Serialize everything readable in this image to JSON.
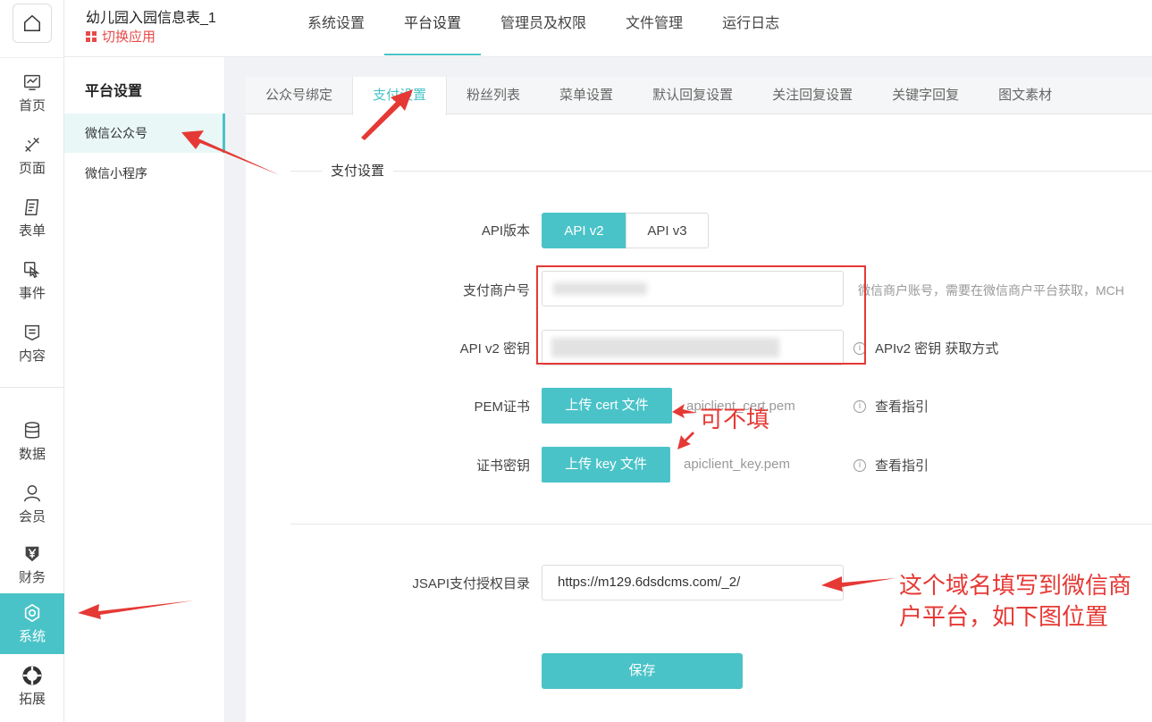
{
  "header": {
    "app_title": "幼儿园入园信息表_1",
    "switch_app": "切换应用",
    "nav": [
      "系统设置",
      "平台设置",
      "管理员及权限",
      "文件管理",
      "运行日志"
    ],
    "active_nav": "平台设置"
  },
  "rail": {
    "items": [
      {
        "label": "首页",
        "icon": "dashboard-icon"
      },
      {
        "label": "页面",
        "icon": "design-icon"
      },
      {
        "label": "表单",
        "icon": "form-icon"
      },
      {
        "label": "事件",
        "icon": "touch-icon"
      },
      {
        "label": "内容",
        "icon": "content-icon"
      },
      {
        "label": "数据",
        "icon": "database-icon"
      },
      {
        "label": "会员",
        "icon": "user-icon"
      },
      {
        "label": "财务",
        "icon": "yen-icon"
      },
      {
        "label": "系统",
        "icon": "settings-icon"
      },
      {
        "label": "拓展",
        "icon": "extension-icon"
      }
    ],
    "active": "系统"
  },
  "subnav": {
    "title": "平台设置",
    "items": [
      "微信公众号",
      "微信小程序"
    ],
    "active": "微信公众号"
  },
  "tabs": {
    "items": [
      "公众号绑定",
      "支付设置",
      "粉丝列表",
      "菜单设置",
      "默认回复设置",
      "关注回复设置",
      "关键字回复",
      "图文素材"
    ],
    "active": "支付设置"
  },
  "form": {
    "section_title": "支付设置",
    "api_version_label": "API版本",
    "api_options": [
      "API v2",
      "API v3"
    ],
    "api_selected": "API v2",
    "merchant_label": "支付商户号",
    "merchant_hint": "微信商户账号，需要在微信商户平台获取，MCH",
    "key_label": "API v2 密钥",
    "key_hint": "APIv2 密钥 获取方式",
    "pem_label": "PEM证书",
    "pem_button": "上传 cert 文件",
    "pem_file": "apiclient_cert.pem",
    "pem_guide": "查看指引",
    "certkey_label": "证书密钥",
    "certkey_button": "上传 key 文件",
    "certkey_file": "apiclient_key.pem",
    "certkey_guide": "查看指引",
    "jsapi_label": "JSAPI支付授权目录",
    "jsapi_value": "https://m129.6dsdcms.com/_2/",
    "save_button": "保存"
  },
  "annotations": {
    "optional": "可不填",
    "domain_note_line1": "这个域名填写到微信商",
    "domain_note_line2": "户平台，如下图位置"
  },
  "colors": {
    "accent": "#4ac3c8",
    "annotation": "#e53935",
    "switch_app": "#e84a4a"
  }
}
